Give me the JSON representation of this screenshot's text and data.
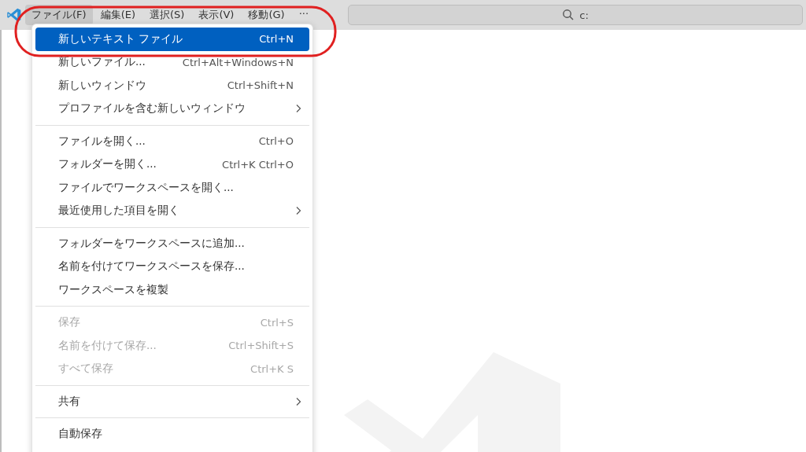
{
  "menubar": [
    {
      "label": "ファイル(F)",
      "selected": true
    },
    {
      "label": "編集(E)",
      "selected": false
    },
    {
      "label": "選択(S)",
      "selected": false
    },
    {
      "label": "表示(V)",
      "selected": false
    },
    {
      "label": "移動(G)",
      "selected": false
    },
    {
      "label": "···",
      "selected": false
    }
  ],
  "search": {
    "value": "c:"
  },
  "menu": {
    "sections": [
      [
        {
          "label": "新しいテキスト ファイル",
          "shortcut": "Ctrl+N",
          "submenu": false,
          "disabled": false,
          "selected": true
        },
        {
          "label": "新しいファイル...",
          "shortcut": "Ctrl+Alt+Windows+N",
          "submenu": false,
          "disabled": false,
          "selected": false
        },
        {
          "label": "新しいウィンドウ",
          "shortcut": "Ctrl+Shift+N",
          "submenu": false,
          "disabled": false,
          "selected": false
        },
        {
          "label": "プロファイルを含む新しいウィンドウ",
          "submenu": true,
          "disabled": false,
          "selected": false
        }
      ],
      [
        {
          "label": "ファイルを開く...",
          "shortcut": "Ctrl+O",
          "submenu": false,
          "disabled": false,
          "selected": false
        },
        {
          "label": "フォルダーを開く...",
          "shortcut": "Ctrl+K Ctrl+O",
          "submenu": false,
          "disabled": false,
          "selected": false
        },
        {
          "label": "ファイルでワークスペースを開く...",
          "submenu": false,
          "disabled": false,
          "selected": false
        },
        {
          "label": "最近使用した項目を開く",
          "submenu": true,
          "disabled": false,
          "selected": false
        }
      ],
      [
        {
          "label": "フォルダーをワークスペースに追加...",
          "submenu": false,
          "disabled": false,
          "selected": false
        },
        {
          "label": "名前を付けてワークスペースを保存...",
          "submenu": false,
          "disabled": false,
          "selected": false
        },
        {
          "label": "ワークスペースを複製",
          "submenu": false,
          "disabled": false,
          "selected": false
        }
      ],
      [
        {
          "label": "保存",
          "shortcut": "Ctrl+S",
          "submenu": false,
          "disabled": true,
          "selected": false
        },
        {
          "label": "名前を付けて保存...",
          "shortcut": "Ctrl+Shift+S",
          "submenu": false,
          "disabled": true,
          "selected": false
        },
        {
          "label": "すべて保存",
          "shortcut": "Ctrl+K S",
          "submenu": false,
          "disabled": true,
          "selected": false
        }
      ],
      [
        {
          "label": "共有",
          "submenu": true,
          "disabled": false,
          "selected": false
        }
      ],
      [
        {
          "label": "自動保存",
          "submenu": false,
          "disabled": false,
          "selected": false
        }
      ]
    ]
  }
}
